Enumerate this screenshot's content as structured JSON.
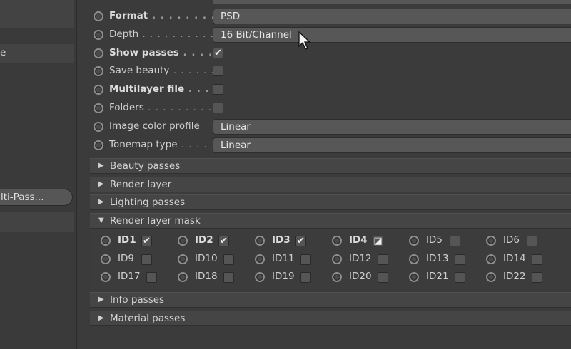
{
  "sidebar": {
    "row_char": "e",
    "multipass_button": "lti-Pass..."
  },
  "main": {
    "separator_value": "_",
    "settings": [
      {
        "label": "Format",
        "dots": " . . . . . . . . .",
        "bold": true,
        "type": "dropdown",
        "value": "PSD"
      },
      {
        "label": "Depth",
        "dots": " . . . . . . . . . .",
        "bold": false,
        "type": "dropdown",
        "value": "16 Bit/Channel"
      },
      {
        "label": "Show passes",
        "dots": " . . . . .",
        "bold": true,
        "type": "check",
        "checked": true
      },
      {
        "label": "Save beauty",
        "dots": " . . . . . .",
        "bold": false,
        "type": "check",
        "checked": false
      },
      {
        "label": "Multilayer file",
        "dots": " . . . .",
        "bold": true,
        "type": "check",
        "checked": false
      },
      {
        "label": "Folders",
        "dots": " . . . . . . . . . .",
        "bold": false,
        "type": "check",
        "checked": false
      },
      {
        "label": "Image color profile",
        "dots": "",
        "bold": false,
        "type": "dropdown",
        "value": "Linear"
      },
      {
        "label": "Tonemap type",
        "dots": " . . . .",
        "bold": false,
        "type": "dropdown",
        "value": "Linear"
      }
    ],
    "sections_collapsed": [
      "Beauty passes",
      "Render layer",
      "Lighting passes"
    ],
    "render_layer_mask": {
      "title": "Render layer mask",
      "ids": [
        {
          "label": "ID1",
          "bold": true,
          "checked": true
        },
        {
          "label": "ID2",
          "bold": true,
          "checked": true
        },
        {
          "label": "ID3",
          "bold": true,
          "checked": true
        },
        {
          "label": "ID4",
          "bold": true,
          "checked": "partial"
        },
        {
          "label": "ID5",
          "bold": false,
          "checked": false
        },
        {
          "label": "ID6",
          "bold": false,
          "checked": false
        },
        {
          "label": "ID9",
          "bold": false,
          "checked": false
        },
        {
          "label": "ID10",
          "bold": false,
          "checked": false
        },
        {
          "label": "ID11",
          "bold": false,
          "checked": false
        },
        {
          "label": "ID12",
          "bold": false,
          "checked": false
        },
        {
          "label": "ID13",
          "bold": false,
          "checked": false
        },
        {
          "label": "ID14",
          "bold": false,
          "checked": false
        },
        {
          "label": "ID17",
          "bold": false,
          "checked": false
        },
        {
          "label": "ID18",
          "bold": false,
          "checked": false
        },
        {
          "label": "ID19",
          "bold": false,
          "checked": false
        },
        {
          "label": "ID20",
          "bold": false,
          "checked": false
        },
        {
          "label": "ID21",
          "bold": false,
          "checked": false
        },
        {
          "label": "ID22",
          "bold": false,
          "checked": false
        }
      ]
    },
    "sections_bottom": [
      "Info passes",
      "Material passes"
    ],
    "check_glyph": "✔",
    "partial_glyph": "◪",
    "arrow_collapsed": "▶",
    "arrow_expanded": "▼"
  }
}
